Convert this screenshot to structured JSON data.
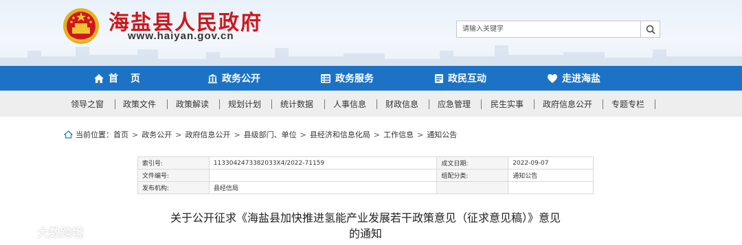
{
  "header": {
    "site_title": "海盐县人民政府",
    "site_url": "www.haiyan.gov.cn",
    "emblem_icon": "national-emblem-icon"
  },
  "search": {
    "placeholder": "请输入关键字",
    "button_icon": "search-icon"
  },
  "main_nav": {
    "items": [
      {
        "label": "首　页",
        "icon": "home-icon"
      },
      {
        "label": "政务公开",
        "icon": "building-icon"
      },
      {
        "label": "政务服务",
        "icon": "document-list-icon"
      },
      {
        "label": "政民互动",
        "icon": "notepad-icon"
      },
      {
        "label": "走进海盐",
        "icon": "heart-icon"
      }
    ]
  },
  "sub_nav": {
    "items": [
      "领导之窗",
      "政策文件",
      "政策解读",
      "规划计划",
      "统计数据",
      "人事信息",
      "财政信息",
      "应急管理",
      "民生实事",
      "政府信息公开",
      "专题专栏"
    ]
  },
  "breadcrumb": {
    "prefix": "当前位置：",
    "items": [
      "首页",
      "政务公开",
      "政府信息公开",
      "县级部门、单位",
      "县经济和信息化局",
      "工作信息",
      "通知公告"
    ]
  },
  "info_table": {
    "rows": [
      [
        "索引号:",
        "1133042473382033X4/2022-71159",
        "成文日期:",
        "2022-09-07"
      ],
      [
        "文件编号:",
        "",
        "组配分类:",
        "通知公告"
      ],
      [
        "发布机构:",
        "县经信局",
        "",
        ""
      ]
    ]
  },
  "article": {
    "title_line1": "关于公开征求《海盐县加快推进氢能产业发展若干政策意见（征求意见稿）》意见",
    "title_line2": "的通知"
  },
  "watermark": {
    "text": "大数跨境"
  },
  "colors": {
    "brand_red": "#d0171c",
    "nav_blue": "#1c73c5",
    "subnav_gray": "#eeeeee"
  }
}
